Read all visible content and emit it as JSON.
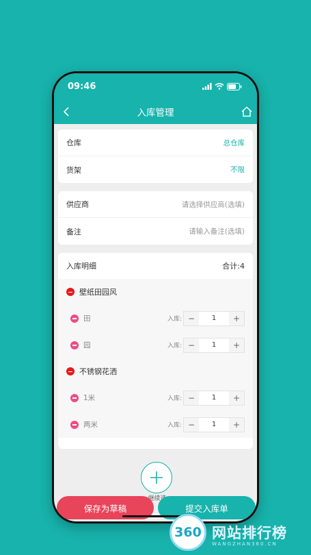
{
  "status": {
    "time": "09:46"
  },
  "nav": {
    "title": "入库管理"
  },
  "warehouse_card": {
    "warehouse_label": "仓库",
    "warehouse_value": "总仓库",
    "shelf_label": "货架",
    "shelf_value": "不限"
  },
  "info_card": {
    "supplier_label": "供应商",
    "supplier_placeholder": "请选择供应商(选填)",
    "remark_label": "备注",
    "remark_placeholder": "请输入备注(选填)"
  },
  "detail": {
    "title": "入库明细",
    "total": "合计:4",
    "qty_label": "入库:",
    "groups": [
      {
        "name": "壁纸田园风",
        "items": [
          {
            "name": "田",
            "qty": "1"
          },
          {
            "name": "园",
            "qty": "1"
          }
        ]
      },
      {
        "name": "不锈钢花洒",
        "items": [
          {
            "name": "1米",
            "qty": "1"
          },
          {
            "name": "两米",
            "qty": "1"
          }
        ]
      }
    ],
    "minus": "−",
    "plus": "+"
  },
  "add": {
    "caption": "继续选"
  },
  "actions": {
    "draft": "保存为草稿",
    "submit": "提交入库单"
  },
  "watermark": {
    "logo": "360",
    "text": "网站排行榜",
    "sub": "WANGZHAN360.CN"
  },
  "colors": {
    "accent": "#17b3ac",
    "draft": "#e8445a",
    "remove_group": "#e8171c",
    "remove_item": "#ef4b86"
  }
}
